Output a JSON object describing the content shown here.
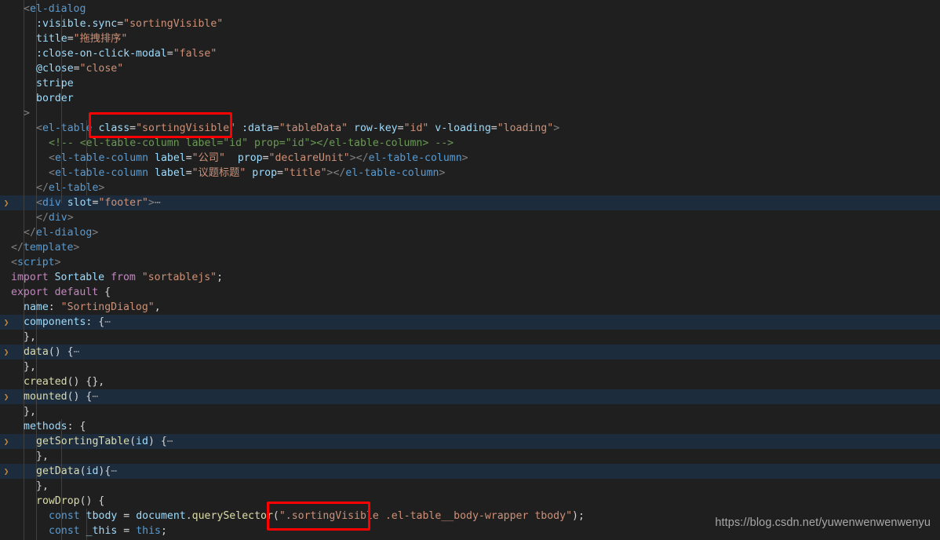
{
  "editor": {
    "language": "vue",
    "theme": "dark-plus",
    "background_color": "#1f1f1f",
    "fold_highlight_color": "#1d2c3c",
    "lines": [
      {
        "n": 1,
        "indent": 1,
        "text": "<el-dialog"
      },
      {
        "n": 2,
        "indent": 2,
        "text": ":visible.sync=\"sortingVisible\""
      },
      {
        "n": 3,
        "indent": 2,
        "text": "title=\"拖拽排序\""
      },
      {
        "n": 4,
        "indent": 2,
        "text": ":close-on-click-modal=\"false\""
      },
      {
        "n": 5,
        "indent": 2,
        "text": "@close=\"close\""
      },
      {
        "n": 6,
        "indent": 2,
        "text": "stripe"
      },
      {
        "n": 7,
        "indent": 2,
        "text": "border"
      },
      {
        "n": 8,
        "indent": 1,
        "text": ">"
      },
      {
        "n": 9,
        "indent": 2,
        "text": "<el-table class=\"sortingVisible\" :data=\"tableData\" row-key=\"id\" v-loading=\"loading\">"
      },
      {
        "n": 10,
        "indent": 3,
        "text": "<!-- <el-table-column label=\"id\" prop=\"id\"></el-table-column> -->"
      },
      {
        "n": 11,
        "indent": 3,
        "text": "<el-table-column label=\"公司\"  prop=\"declareUnit\"></el-table-column>"
      },
      {
        "n": 12,
        "indent": 3,
        "text": "<el-table-column label=\"议题标题\" prop=\"title\"></el-table-column>"
      },
      {
        "n": 13,
        "indent": 2,
        "text": "</el-table>"
      },
      {
        "n": 14,
        "indent": 2,
        "text": "<div slot=\"footer\">…"
      },
      {
        "n": 15,
        "indent": 2,
        "text": "</div>"
      },
      {
        "n": 16,
        "indent": 1,
        "text": "</el-dialog>"
      },
      {
        "n": 17,
        "indent": 0,
        "text": "</template>"
      },
      {
        "n": 18,
        "indent": 0,
        "text": "<script>"
      },
      {
        "n": 19,
        "indent": 0,
        "text": "import Sortable from \"sortablejs\";"
      },
      {
        "n": 20,
        "indent": 0,
        "text": "export default {"
      },
      {
        "n": 21,
        "indent": 1,
        "text": "name: \"SortingDialog\","
      },
      {
        "n": 22,
        "indent": 1,
        "text": "components: {…"
      },
      {
        "n": 23,
        "indent": 1,
        "text": "},"
      },
      {
        "n": 24,
        "indent": 1,
        "text": "data() {…"
      },
      {
        "n": 25,
        "indent": 1,
        "text": "},"
      },
      {
        "n": 26,
        "indent": 1,
        "text": "created() {},"
      },
      {
        "n": 27,
        "indent": 1,
        "text": "mounted() {…"
      },
      {
        "n": 28,
        "indent": 1,
        "text": "},"
      },
      {
        "n": 29,
        "indent": 1,
        "text": "methods: {"
      },
      {
        "n": 30,
        "indent": 2,
        "text": "getSortingTable(id) {…"
      },
      {
        "n": 31,
        "indent": 2,
        "text": "},"
      },
      {
        "n": 32,
        "indent": 2,
        "text": "getData(id){…"
      },
      {
        "n": 33,
        "indent": 2,
        "text": "},"
      },
      {
        "n": 34,
        "indent": 2,
        "text": "rowDrop() {"
      },
      {
        "n": 35,
        "indent": 3,
        "text": "const tbody = document.querySelector(\".sortingVisible .el-table__body-wrapper tbody\");"
      },
      {
        "n": 36,
        "indent": 3,
        "text": "const _this = this;"
      }
    ],
    "folded_rows": [
      14,
      22,
      24,
      27,
      30,
      32
    ],
    "fold_chevron_glyph": "❯"
  },
  "annotations": [
    {
      "id": "annotation-class-attribute",
      "label": "class=\"sortingVisible\"",
      "color": "#fe0000"
    },
    {
      "id": "annotation-selector-string",
      "label": "\".sortingVisible",
      "color": "#fe0000"
    }
  ],
  "watermark": {
    "text": "https://blog.csdn.net/yuwenwenwenwenyu"
  }
}
